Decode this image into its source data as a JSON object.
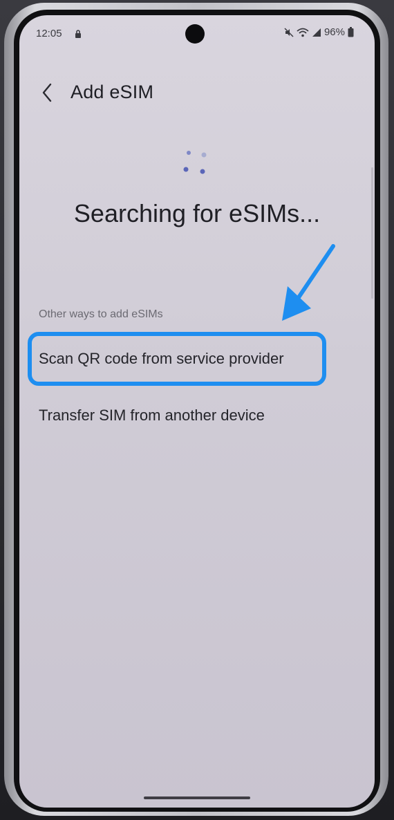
{
  "status_bar": {
    "time": "12:05",
    "battery": "96%",
    "icons": [
      "lock-icon",
      "mute-icon",
      "wifi-icon",
      "signal-icon",
      "battery-icon"
    ]
  },
  "header": {
    "back_icon": "chevron-left-icon",
    "title": "Add eSIM"
  },
  "main": {
    "status_text": "Searching for eSIMs...",
    "section_label": "Other ways to add eSIMs",
    "options": [
      {
        "label": "Scan QR code from service provider"
      },
      {
        "label": "Transfer SIM from another device"
      }
    ]
  },
  "colors": {
    "highlight": "#1e8ef0",
    "spinner": "#5b66b8",
    "background": "#d3cfd9"
  }
}
